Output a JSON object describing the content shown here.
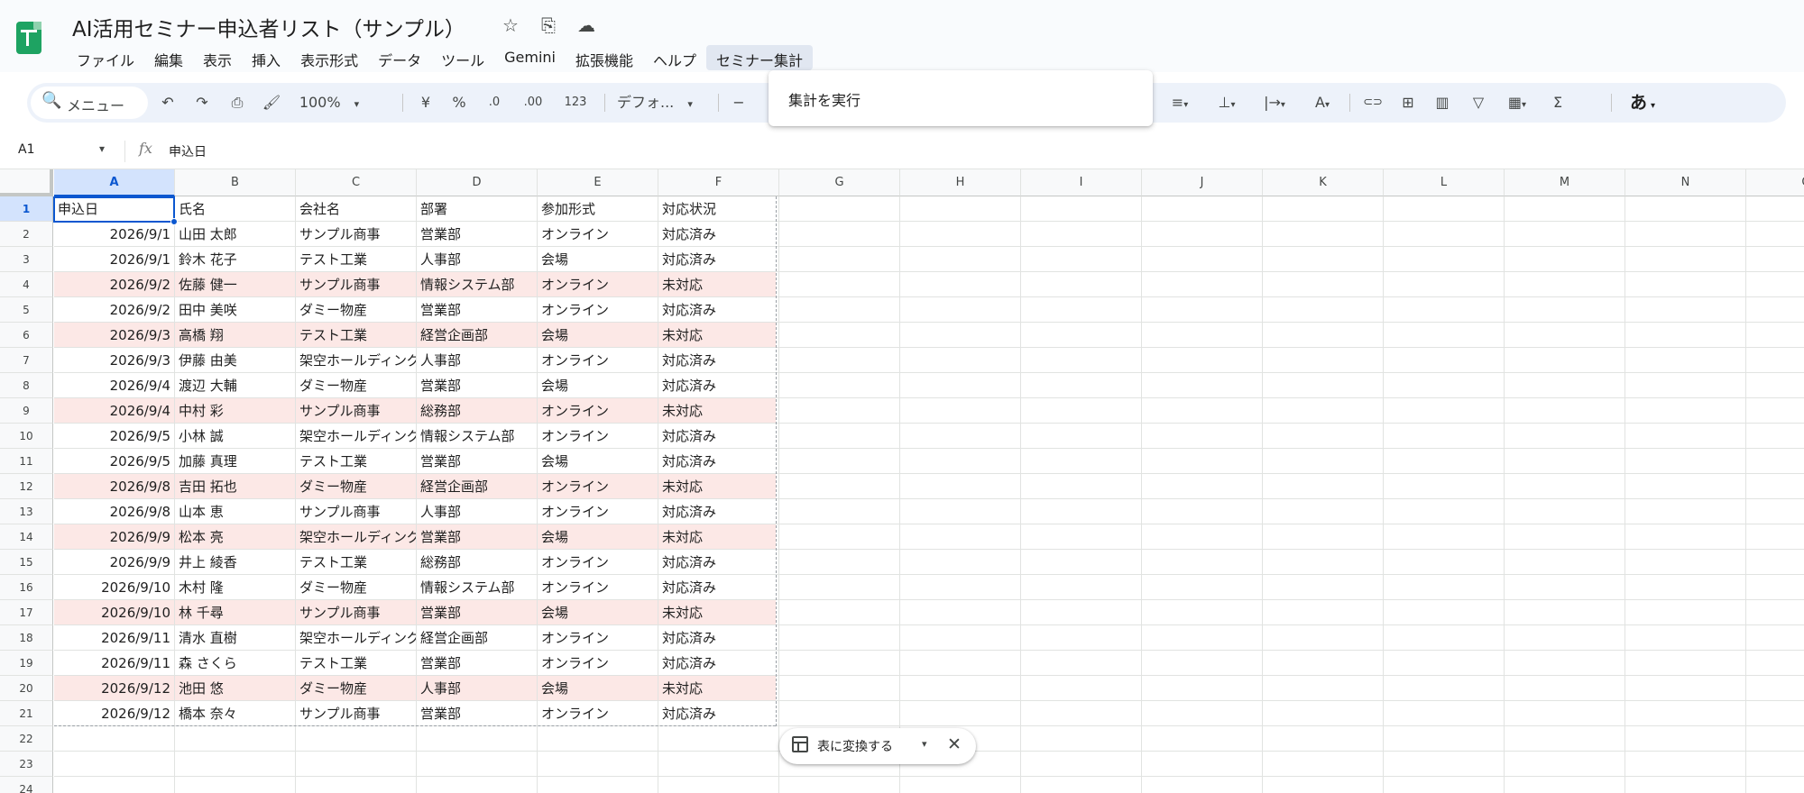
{
  "app": {
    "title": "AI活用セミナー申込者リスト（サンプル）",
    "icons": {
      "star": "☆",
      "folder": "⎘",
      "cloud": "☁"
    }
  },
  "menu": {
    "items": [
      "ファイル",
      "編集",
      "表示",
      "挿入",
      "表示形式",
      "データ",
      "ツール",
      "Gemini",
      "拡張機能",
      "ヘルプ",
      "セミナー集計"
    ],
    "active_index": 10
  },
  "toolbar": {
    "search_icon": "🔍",
    "search_label": "メニュー",
    "undo": "↶",
    "redo": "↷",
    "print": "⎙",
    "paint_format": "🖌",
    "zoom": "100%",
    "currency": "¥",
    "percent": "%",
    "decimal_decrease": ".0",
    "decimal_increase": ".00",
    "number_format": "123",
    "font": "デフォ...",
    "font_size_decrease": "−",
    "align": "≡",
    "valign": "⊥",
    "wrap": "|→",
    "text_color": "A",
    "link": "⊂⊃",
    "comment": "⊞",
    "chart": "▥",
    "filter": "▽",
    "views": "▦",
    "functions": "Σ",
    "input_tools": "あ",
    "caret": "▾"
  },
  "dropdown": {
    "item": "集計を実行"
  },
  "formula_bar": {
    "name_box": "A1",
    "name_box_arrow": "▾",
    "fx": "fx",
    "content": "申込日"
  },
  "sheet": {
    "columns": [
      "A",
      "B",
      "C",
      "D",
      "E",
      "F",
      "G",
      "H",
      "I",
      "J",
      "K",
      "L",
      "M",
      "N",
      "O"
    ],
    "headers": [
      "申込日",
      "氏名",
      "会社名",
      "部署",
      "参加形式",
      "対応状況"
    ],
    "rows": [
      [
        "2026/9/1",
        "山田 太郎",
        "サンプル商事",
        "営業部",
        "オンライン",
        "対応済み"
      ],
      [
        "2026/9/1",
        "鈴木 花子",
        "テスト工業",
        "人事部",
        "会場",
        "対応済み"
      ],
      [
        "2026/9/2",
        "佐藤 健一",
        "サンプル商事",
        "情報システム部",
        "オンライン",
        "未対応"
      ],
      [
        "2026/9/2",
        "田中 美咲",
        "ダミー物産",
        "営業部",
        "オンライン",
        "対応済み"
      ],
      [
        "2026/9/3",
        "高橋 翔",
        "テスト工業",
        "経営企画部",
        "会場",
        "未対応"
      ],
      [
        "2026/9/3",
        "伊藤 由美",
        "架空ホールディングス",
        "人事部",
        "オンライン",
        "対応済み"
      ],
      [
        "2026/9/4",
        "渡辺 大輔",
        "ダミー物産",
        "営業部",
        "会場",
        "対応済み"
      ],
      [
        "2026/9/4",
        "中村 彩",
        "サンプル商事",
        "総務部",
        "オンライン",
        "未対応"
      ],
      [
        "2026/9/5",
        "小林 誠",
        "架空ホールディングス",
        "情報システム部",
        "オンライン",
        "対応済み"
      ],
      [
        "2026/9/5",
        "加藤 真理",
        "テスト工業",
        "営業部",
        "会場",
        "対応済み"
      ],
      [
        "2026/9/8",
        "吉田 拓也",
        "ダミー物産",
        "経営企画部",
        "オンライン",
        "未対応"
      ],
      [
        "2026/9/8",
        "山本 恵",
        "サンプル商事",
        "人事部",
        "オンライン",
        "対応済み"
      ],
      [
        "2026/9/9",
        "松本 亮",
        "架空ホールディングス",
        "営業部",
        "会場",
        "未対応"
      ],
      [
        "2026/9/9",
        "井上 綾香",
        "テスト工業",
        "総務部",
        "オンライン",
        "対応済み"
      ],
      [
        "2026/9/10",
        "木村 隆",
        "ダミー物産",
        "情報システム部",
        "オンライン",
        "対応済み"
      ],
      [
        "2026/9/10",
        "林 千尋",
        "サンプル商事",
        "営業部",
        "会場",
        "未対応"
      ],
      [
        "2026/9/11",
        "清水 直樹",
        "架空ホールディングス",
        "経営企画部",
        "オンライン",
        "対応済み"
      ],
      [
        "2026/9/11",
        "森 さくら",
        "テスト工業",
        "営業部",
        "オンライン",
        "対応済み"
      ],
      [
        "2026/9/12",
        "池田 悠",
        "ダミー物産",
        "人事部",
        "会場",
        "未対応"
      ],
      [
        "2026/9/12",
        "橋本 奈々",
        "サンプル商事",
        "営業部",
        "オンライン",
        "対応済み"
      ]
    ],
    "row_count_visible": 24,
    "highlight_status": "未対応",
    "highlight_color": "#fce8e6"
  },
  "chip": {
    "label": "表に変換する",
    "arrow": "▾",
    "close": "✕"
  },
  "colors": {
    "accent": "#0b57d0",
    "brand": "#1ea362"
  }
}
